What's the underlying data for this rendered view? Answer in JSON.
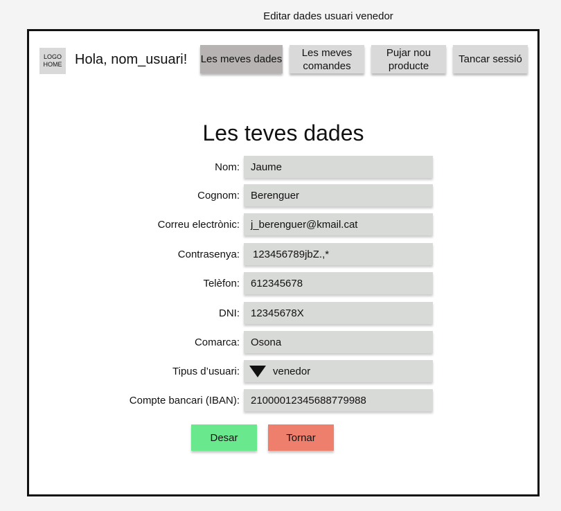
{
  "frame_title": "Editar dades usuari venedor",
  "header": {
    "logo_text": "LOGO\nHOME",
    "greeting": "Hola, nom_usuari!",
    "nav": [
      {
        "label": "Les meves dades"
      },
      {
        "label": "Les meves comandes"
      },
      {
        "label": "Pujar nou producte"
      },
      {
        "label": "Tancar sessió"
      }
    ]
  },
  "form": {
    "title": "Les teves dades",
    "fields": [
      {
        "label": "Nom:",
        "value": "Jaume"
      },
      {
        "label": "Cognom:",
        "value": "Berenguer"
      },
      {
        "label": "Correu electrònic:",
        "value": "j_berenguer@kmail.cat"
      },
      {
        "label": "Contrasenya:",
        "value": "123456789jbZ.,*"
      },
      {
        "label": "Telèfon:",
        "value": "612345678"
      },
      {
        "label": "DNI:",
        "value": "12345678X"
      },
      {
        "label": "Comarca:",
        "value": "Osona"
      },
      {
        "label": "Tipus d’usuari:",
        "value": "venedor"
      },
      {
        "label": "Compte bancari (IBAN):",
        "value": "21000012345688779988"
      }
    ],
    "save_label": "Desar",
    "back_label": "Tornar"
  },
  "colors": {
    "save": "#6ae88e",
    "back": "#ee7f6d",
    "field_bg": "#d8dad7",
    "nav_active": "#b7b3b3",
    "nav_bg": "#d9d9d9"
  }
}
